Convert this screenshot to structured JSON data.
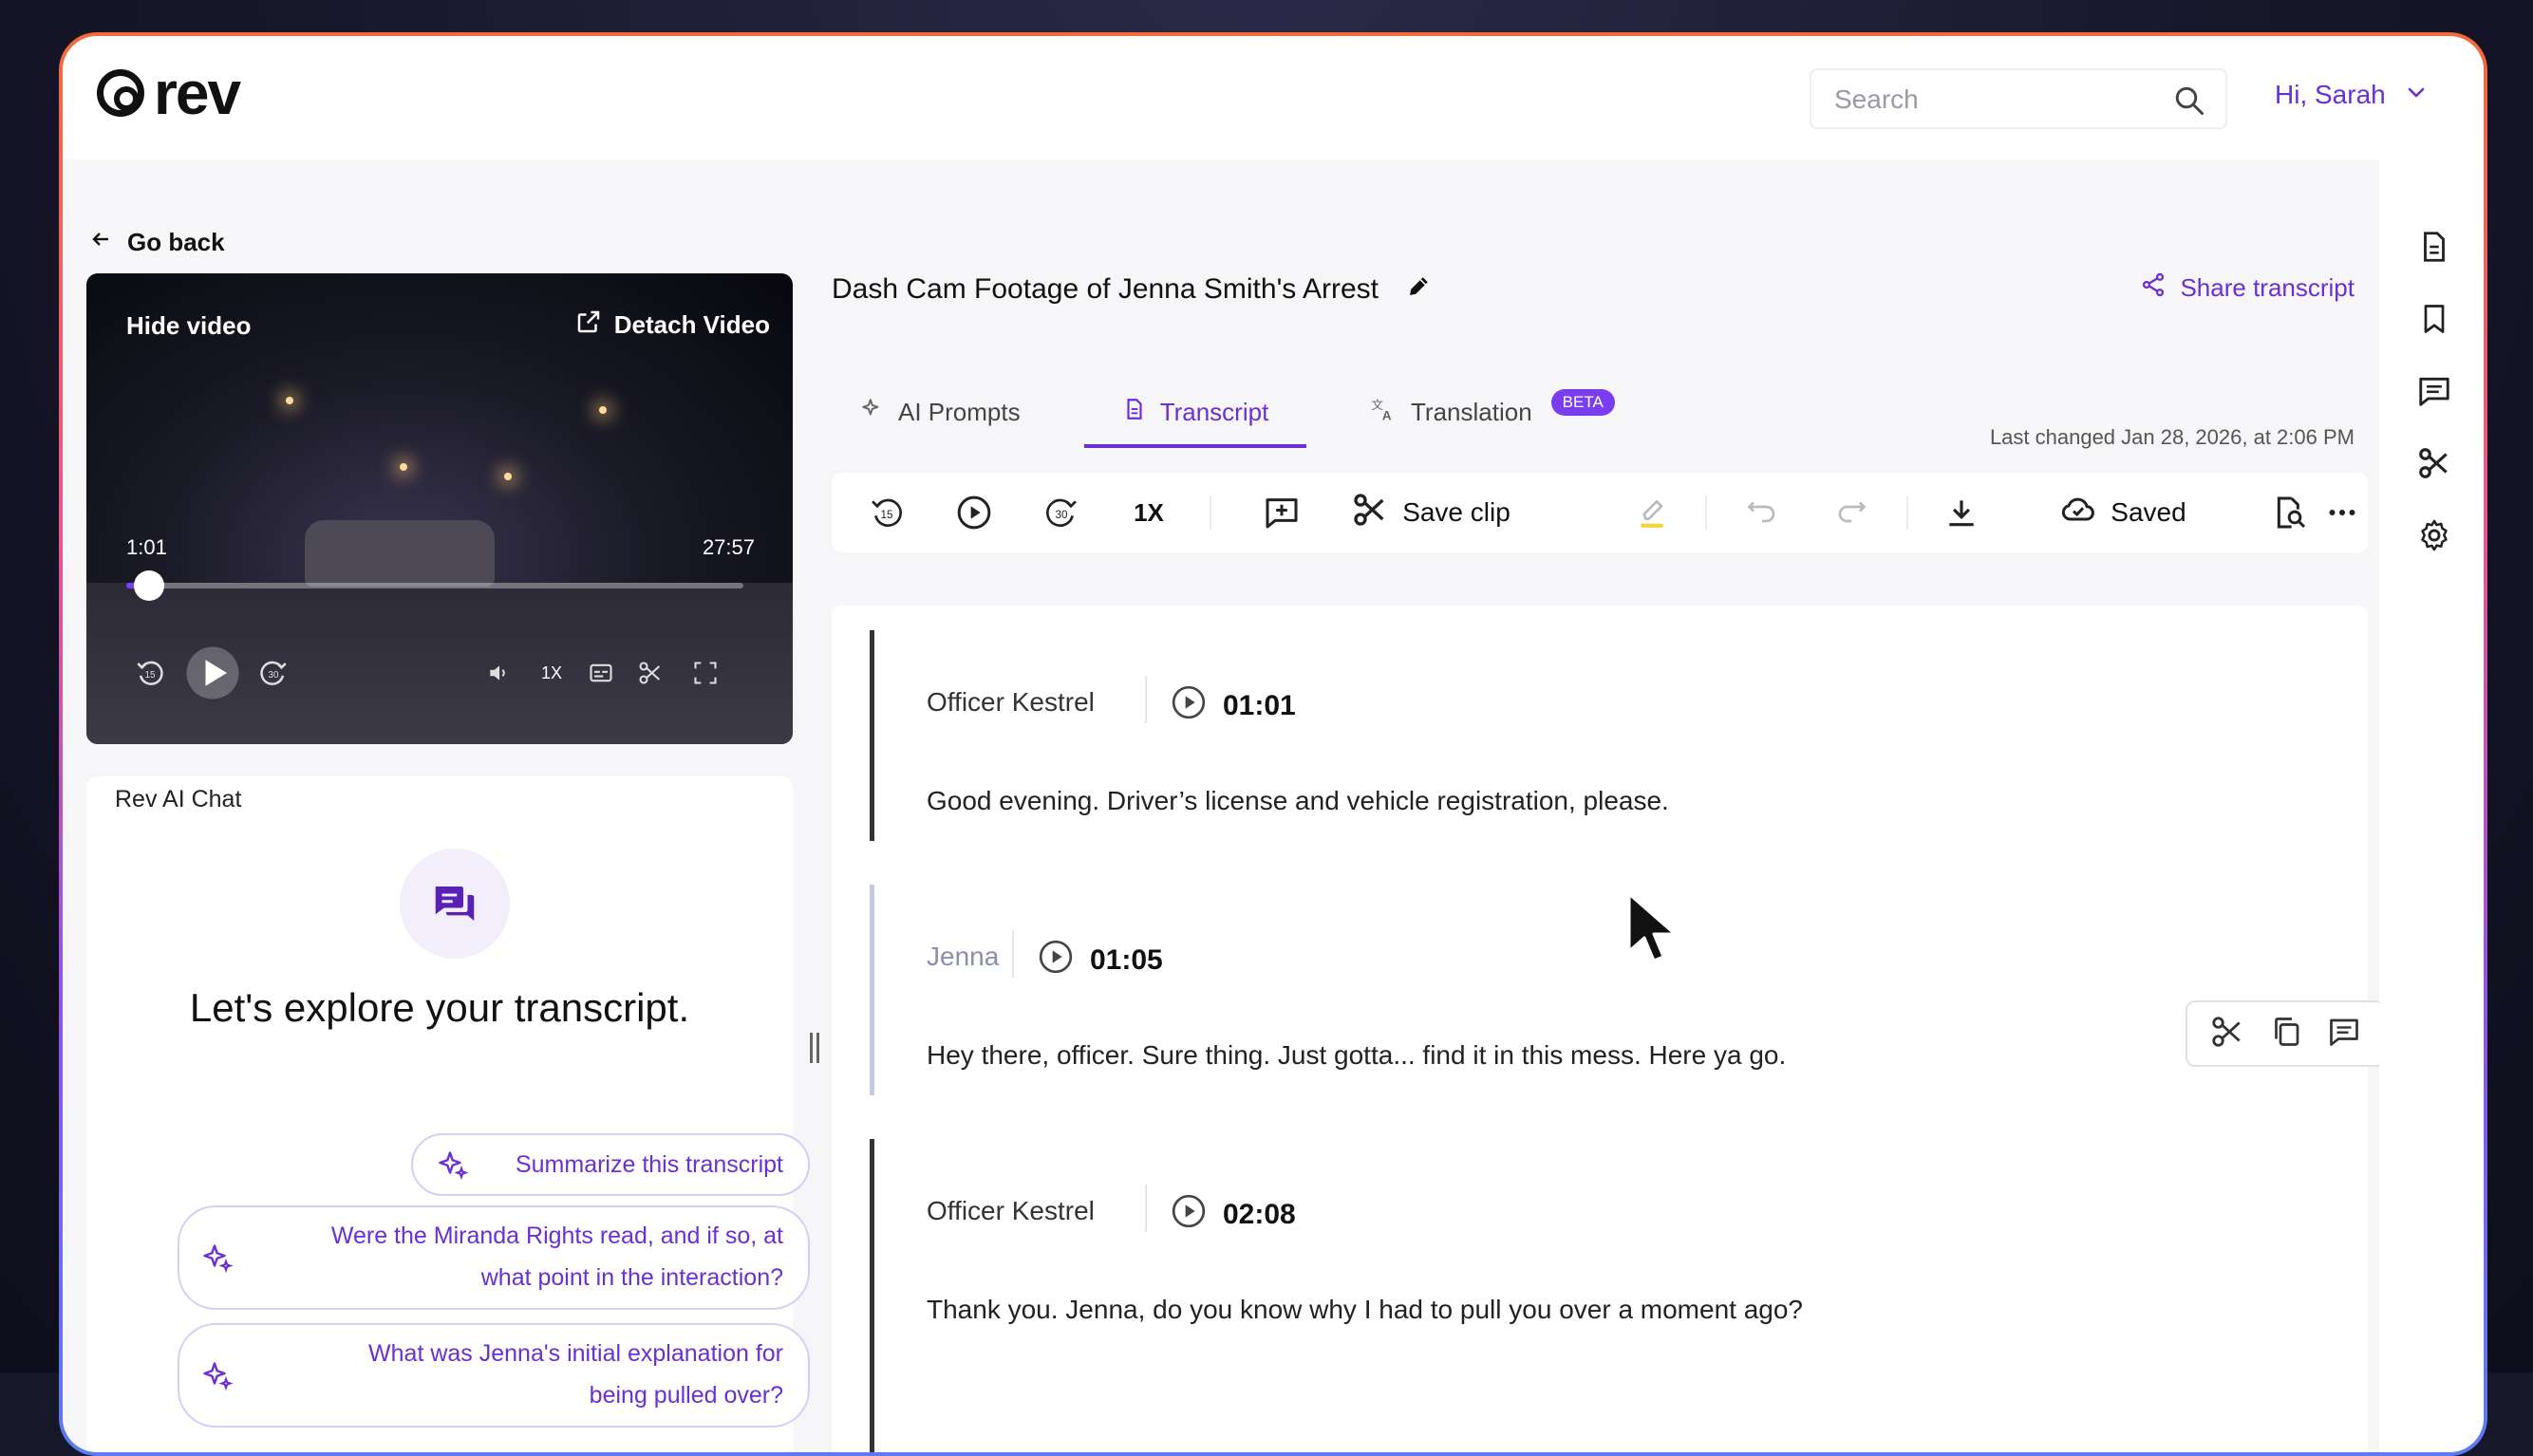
{
  "header": {
    "logo_text": "rev",
    "search_placeholder": "Search",
    "user_greeting": "Hi, Sarah"
  },
  "nav": {
    "go_back": "Go back"
  },
  "video": {
    "hide_label": "Hide video",
    "detach_label": "Detach Video",
    "current_time": "1:01",
    "duration": "27:57",
    "progress_fraction": 0.0364,
    "rewind_label": "15",
    "forward_label": "30",
    "speed_label": "1X"
  },
  "chat": {
    "title": "Rev AI Chat",
    "heading": "Let's explore your transcript.",
    "suggestions": [
      {
        "text": "Summarize this transcript"
      },
      {
        "line1": "Were the Miranda Rights read, and if so, at",
        "line2": "what point in the interaction?"
      },
      {
        "line1": "What was Jenna's initial explanation for",
        "line2": "being pulled over?"
      }
    ]
  },
  "document": {
    "title": "Dash Cam Footage of Jenna Smith's Arrest",
    "share_label": "Share transcript",
    "last_changed": "Last changed Jan 28, 2026, at 2:06 PM"
  },
  "tabs": [
    {
      "label": "AI Prompts",
      "icon": "sparkle-icon",
      "active": false
    },
    {
      "label": "Transcript",
      "icon": "document-icon",
      "active": true
    },
    {
      "label": "Translation",
      "icon": "translate-icon",
      "active": false,
      "badge": "BETA"
    }
  ],
  "toolbar": {
    "rewind_label": "15",
    "forward_label": "30",
    "speed_label": "1X",
    "save_clip_label": "Save clip",
    "saved_label": "Saved"
  },
  "transcript": [
    {
      "speaker": "Officer Kestrel",
      "time": "01:01",
      "text": "Good evening. Driver’s license and vehicle registration, please.",
      "muted": false
    },
    {
      "speaker": "Jenna",
      "time": "01:05",
      "text": "Hey there, officer. Sure thing. Just gotta... find it in this mess. Here ya go.",
      "muted": true
    },
    {
      "speaker": "Officer Kestrel",
      "time": "02:08",
      "text": "Thank you. Jenna, do you know why I had to pull you over a moment ago?",
      "muted": false
    }
  ],
  "colors": {
    "accent": "#6b2fd6",
    "accent_light": "#f2eefc",
    "frame_gradient_top": "#f26b3a",
    "frame_gradient_bottom": "#5b7cf0",
    "highlighter": "#f3d23a"
  }
}
